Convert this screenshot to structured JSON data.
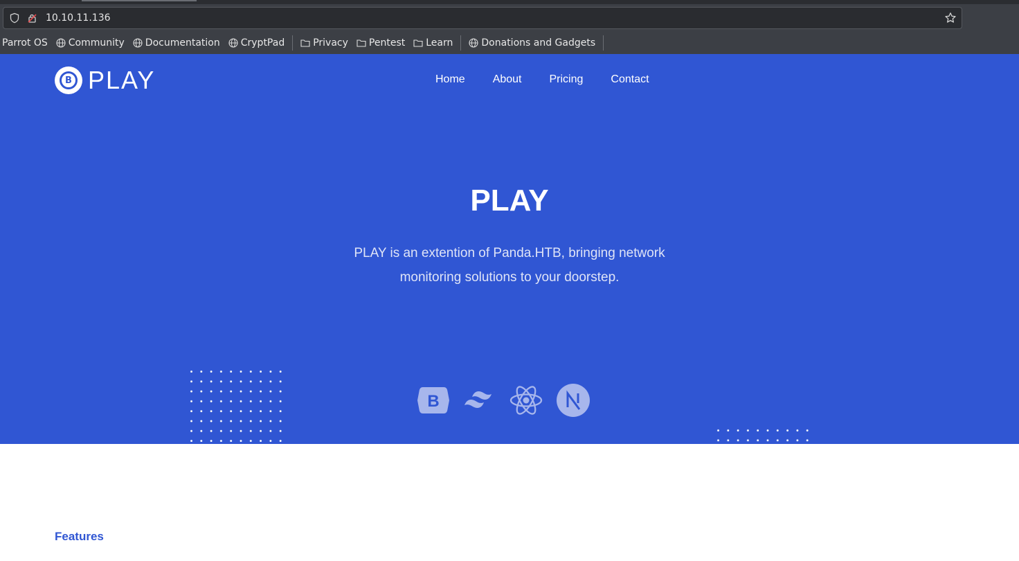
{
  "browser": {
    "url": "10.10.11.136",
    "bookmarks": [
      {
        "label": "Parrot OS",
        "icon": "none"
      },
      {
        "label": "Community",
        "icon": "globe-icon"
      },
      {
        "label": "Documentation",
        "icon": "globe-icon"
      },
      {
        "label": "CryptPad",
        "icon": "globe-icon"
      },
      {
        "label": "Privacy",
        "icon": "folder-icon"
      },
      {
        "label": "Pentest",
        "icon": "folder-icon"
      },
      {
        "label": "Learn",
        "icon": "folder-icon"
      },
      {
        "label": "Donations and Gadgets",
        "icon": "globe-icon"
      }
    ]
  },
  "site": {
    "logo_text": "PLAY",
    "logo_badge": "B",
    "nav": [
      "Home",
      "About",
      "Pricing",
      "Contact"
    ],
    "hero_title": "PLAY",
    "hero_subtitle_line1": "PLAY is an extention of Panda.HTB, bringing network",
    "hero_subtitle_line2": "monitoring solutions to your doorstep.",
    "tech_icons": [
      "bootstrap-icon",
      "tailwind-icon",
      "react-icon",
      "nextjs-icon"
    ],
    "features_label": "Features"
  },
  "colors": {
    "hero_bg": "#3056d3",
    "accent": "#3056d3",
    "chrome_bg": "#3c3f45"
  }
}
